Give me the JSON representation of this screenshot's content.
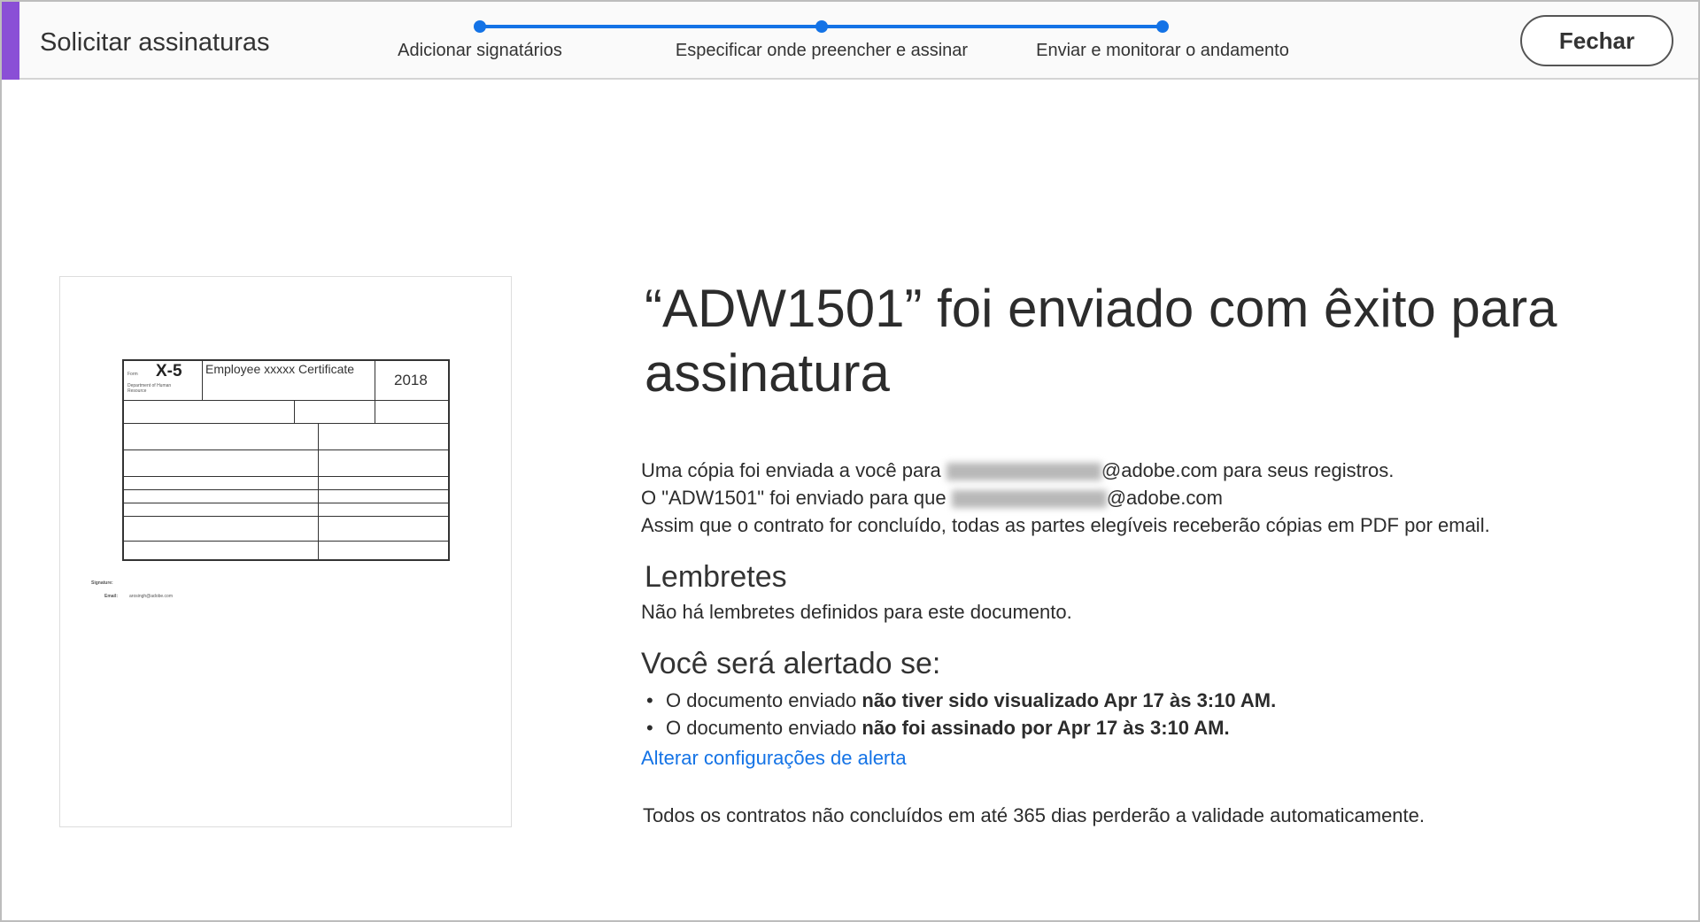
{
  "header": {
    "title": "Solicitar assinaturas",
    "close_label": "Fechar",
    "steps": [
      "Adicionar signatários",
      "Especificar onde preencher e assinar",
      "Enviar e monitorar o andamento"
    ]
  },
  "thumbnail": {
    "form_label": "Form",
    "form_number": "X-5",
    "form_title": "Employee xxxxx Certificate",
    "year": "2018",
    "dept": "Department of Human Resource",
    "signature_label": "Signature:",
    "email_label": "Email:",
    "email_value": "arosingh@adobe.com"
  },
  "main": {
    "heading": "“ADW1501” foi enviado com êxito para assinatura",
    "copy_prefix": "Uma cópia foi enviada a você para ",
    "copy_suffix": "@adobe.com para seus registros.",
    "sent_prefix": "O \"ADW1501\" foi enviado para que ",
    "sent_suffix": "@adobe.com",
    "completion": "Assim que o contrato for concluído, todas as partes elegíveis receberão cópias em PDF por email.",
    "reminders_title": "Lembretes",
    "reminders_text": "Não há lembretes definidos para este documento.",
    "alerts_title": "Você será alertado se:",
    "alerts": [
      {
        "prefix": "O documento enviado ",
        "bold": "não tiver sido visualizado Apr 17 às 3:10 AM."
      },
      {
        "prefix": "O documento enviado ",
        "bold": "não foi assinado por Apr 17 às 3:10 AM."
      }
    ],
    "alert_link": "Alterar configurações de alerta",
    "expiry": "Todos os contratos não concluídos em até 365 dias perderão a validade automaticamente."
  }
}
